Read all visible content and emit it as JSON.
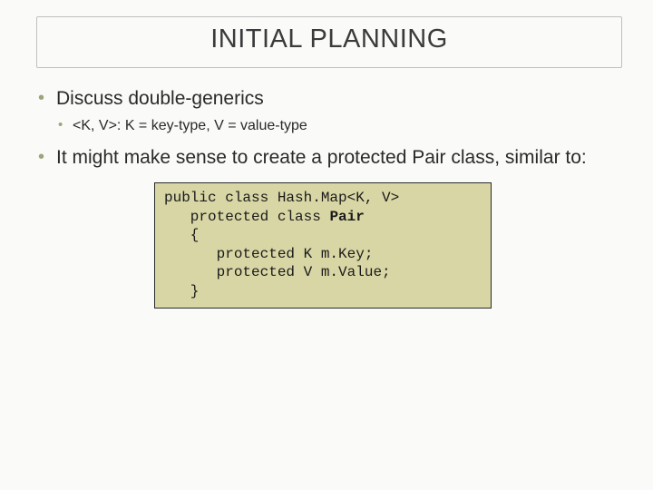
{
  "title": "INITIAL PLANNING",
  "bullets": {
    "b1": "Discuss double-generics",
    "b1a": "<K, V>: K = key-type, V = value-type",
    "b2": "It might make sense to create a protected Pair class, similar to:"
  },
  "code": {
    "l1": "public class Hash.Map<K, V>",
    "l2": "   protected class ",
    "l2b": "Pair",
    "l3": "   {",
    "l4": "      protected K m.Key;",
    "l5": "      protected V m.Value;",
    "l6": "   }"
  }
}
